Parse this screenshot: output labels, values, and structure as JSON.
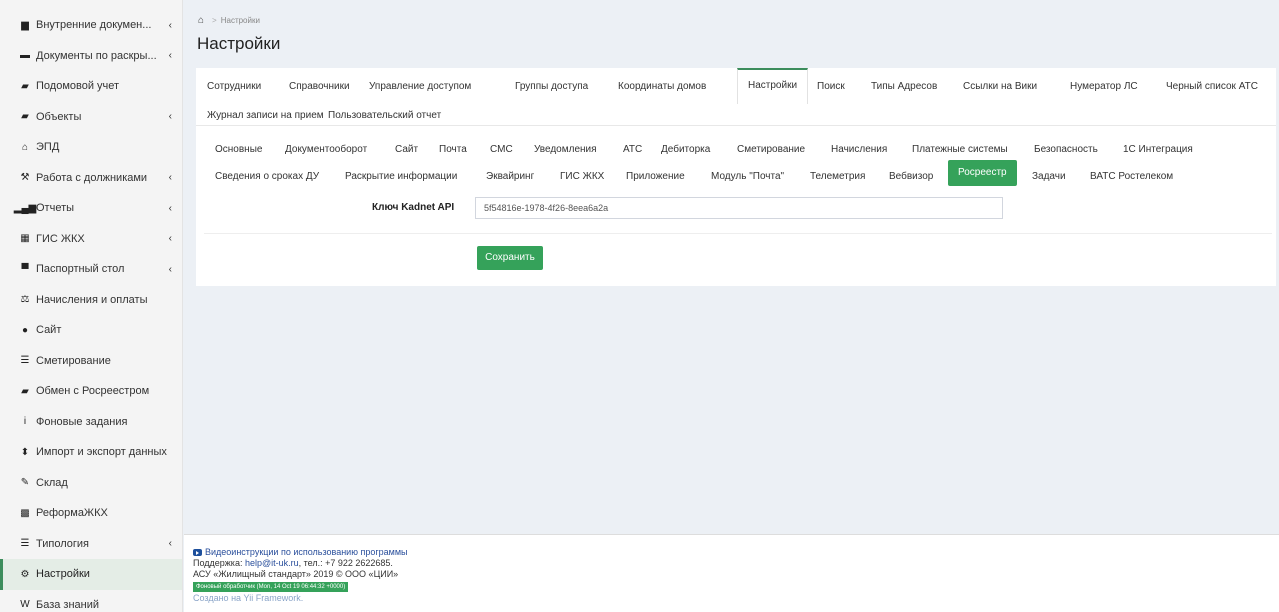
{
  "sidebar": {
    "items": [
      {
        "icon": "file-icon",
        "glyph": "▆",
        "label": "Внутренние докумен...",
        "chev": "‹"
      },
      {
        "icon": "bank-icon",
        "glyph": "▬",
        "label": "Документы по раскры...",
        "chev": "‹"
      },
      {
        "icon": "id-card-icon",
        "glyph": "▰",
        "label": "Подомовой учет",
        "chev": ""
      },
      {
        "icon": "folder-icon",
        "glyph": "▰",
        "label": "Объекты",
        "chev": "‹"
      },
      {
        "icon": "home-icon",
        "glyph": "⌂",
        "label": "ЭПД",
        "chev": ""
      },
      {
        "icon": "gavel-icon",
        "glyph": "⚒",
        "label": "Работа с должниками",
        "chev": "‹"
      },
      {
        "icon": "bar-chart-icon",
        "glyph": "▂▄▆",
        "label": "Отчеты",
        "chev": "‹"
      },
      {
        "icon": "grid-icon",
        "glyph": "▦",
        "label": "ГИС ЖКХ",
        "chev": "‹"
      },
      {
        "icon": "passport-icon",
        "glyph": "▀",
        "label": "Паспортный стол",
        "chev": "‹"
      },
      {
        "icon": "balance-icon",
        "glyph": "⚖",
        "label": "Начисления и оплаты",
        "chev": ""
      },
      {
        "icon": "comment-icon",
        "glyph": "●",
        "label": "Сайт",
        "chev": ""
      },
      {
        "icon": "list-icon",
        "glyph": "☰",
        "label": "Сметирование",
        "chev": ""
      },
      {
        "icon": "building-icon",
        "glyph": "▰",
        "label": "Обмен с Росреестром",
        "chev": ""
      },
      {
        "icon": "info-icon",
        "glyph": "i",
        "label": "Фоновые задания",
        "chev": ""
      },
      {
        "icon": "sort-icon",
        "glyph": "⬍",
        "label": "Импорт и экспорт данных",
        "chev": ""
      },
      {
        "icon": "wrench-icon",
        "glyph": "✎",
        "label": "Склад",
        "chev": ""
      },
      {
        "icon": "th-large-icon",
        "glyph": "▩",
        "label": "РеформаЖКХ",
        "chev": ""
      },
      {
        "icon": "list-icon",
        "glyph": "☰",
        "label": "Типология",
        "chev": "‹"
      },
      {
        "icon": "cogs-icon",
        "glyph": "⚙",
        "label": "Настройки",
        "chev": "",
        "active": true
      },
      {
        "icon": "wikipedia-icon",
        "glyph": "W",
        "label": "База знаний",
        "chev": ""
      }
    ]
  },
  "breadcrumb": {
    "current": "Настройки",
    "separator": ">"
  },
  "page_title": "Настройки",
  "tabs_main": [
    "Сотрудники",
    "Справочники",
    "Управление доступом",
    "Группы доступа",
    "Координаты домов",
    "Настройки",
    "Поиск",
    "Типы Адресов",
    "Ссылки на Вики",
    "Нумератор ЛС",
    "Черный список АТС",
    "Журнал записи на прием",
    "Пользовательский отчет"
  ],
  "tabs_main_active": "Настройки",
  "tabs_sub": [
    "Основные",
    "Документооборот",
    "Сайт",
    "Почта",
    "СМС",
    "Уведомления",
    "АТС",
    "Дебиторка",
    "Сметирование",
    "Начисления",
    "Платежные системы",
    "Безопасность",
    "1С Интеграция",
    "Сведения о сроках ДУ",
    "Раскрытие информации",
    "Эквайринг",
    "ГИС ЖКХ",
    "Приложение",
    "Модуль \"Почта\"",
    "Телеметрия",
    "Вебвизор",
    "Росреестр",
    "Задачи",
    "ВАТС Ростелеком"
  ],
  "tabs_sub_active": "Росреестр",
  "form": {
    "label": "Ключ Kadnet API",
    "value": "5f54816e-1978-4f26-8eea6a2a",
    "save_label": "Сохранить"
  },
  "footer": {
    "video_link": "Видеоинструкции по использованию программы",
    "support_prefix": "Поддержка: ",
    "support_email": "help@it-uk.ru",
    "support_phone": ", тел.: +7 922 2622685.",
    "copyright": "АСУ «Жилищный стандарт» 2019 © ООО «ЦИИ»",
    "bg_badge": "Фоновый обработчик (Mon, 14 Oct 19 06:44:32 +0000)",
    "made_with": "Создано на Yii Framework."
  },
  "colors": {
    "accent": "#35a25a",
    "link": "#2a4f9c"
  }
}
